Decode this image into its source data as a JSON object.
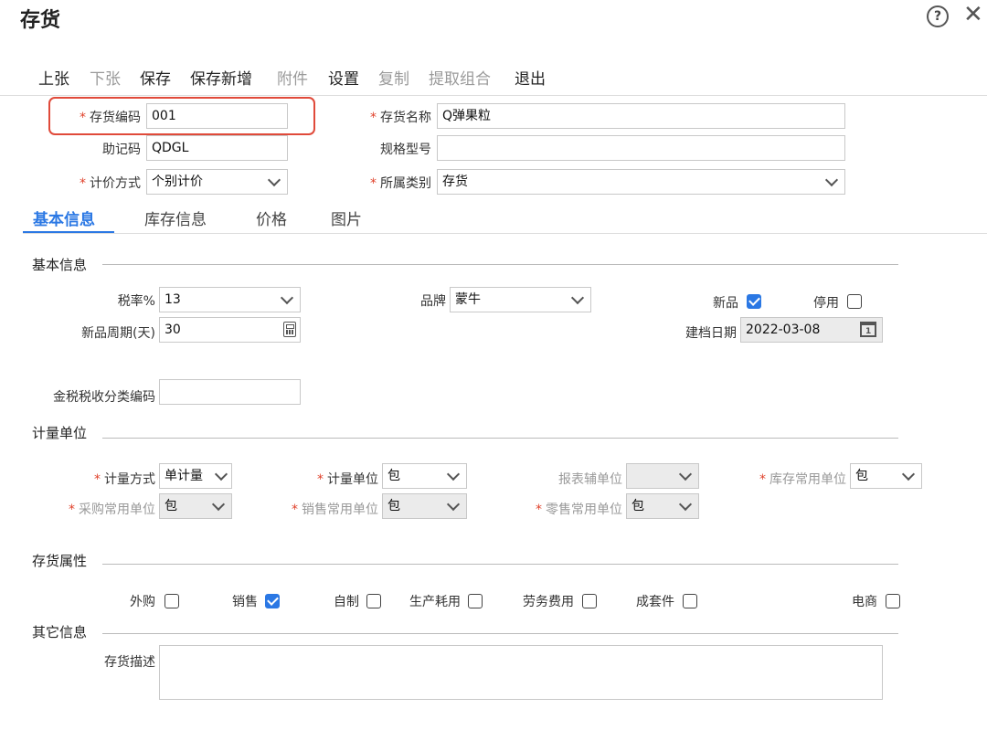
{
  "window": {
    "title": "存货",
    "help_symbol": "?",
    "close_symbol": "✕"
  },
  "toolbar": [
    {
      "label": "上张",
      "enabled": true
    },
    {
      "label": "下张",
      "enabled": false
    },
    {
      "label": "保存",
      "enabled": true
    },
    {
      "label": "保存新增",
      "enabled": true
    },
    {
      "label": "附件",
      "enabled": false
    },
    {
      "label": "设置",
      "enabled": true
    },
    {
      "label": "复制",
      "enabled": false
    },
    {
      "label": "提取组合",
      "enabled": false
    },
    {
      "label": "退出",
      "enabled": true
    }
  ],
  "header": {
    "code_label": "存货编码",
    "code_value": "001",
    "name_label": "存货名称",
    "name_value": "Q弹果粒",
    "mnemonic_label": "助记码",
    "mnemonic_value": "QDGL",
    "spec_label": "规格型号",
    "spec_value": "",
    "pricing_label": "计价方式",
    "pricing_value": "个别计价",
    "category_label": "所属类别",
    "category_value": "存货",
    "required_mark": "*"
  },
  "tabs": [
    {
      "label": "基本信息",
      "active": true
    },
    {
      "label": "库存信息",
      "active": false
    },
    {
      "label": "价格",
      "active": false
    },
    {
      "label": "图片",
      "active": false
    }
  ],
  "basic": {
    "section": "基本信息",
    "tax_label": "税率%",
    "tax_value": "13",
    "brand_label": "品牌",
    "brand_value": "蒙牛",
    "new_label": "新品",
    "new_checked": true,
    "disabled_label": "停用",
    "disabled_checked": false,
    "cycle_label": "新品周期(天)",
    "cycle_value": "30",
    "date_label": "建档日期",
    "date_value": "2022-03-08",
    "taxcode_label": "金税税收分类编码",
    "taxcode_value": ""
  },
  "units": {
    "section": "计量单位",
    "method_label": "计量方式",
    "method_value": "单计量",
    "unit_label": "计量单位",
    "unit_value": "包",
    "report_label": "报表辅单位",
    "report_value": "",
    "stock_label": "库存常用单位",
    "stock_value": "包",
    "purchase_label": "采购常用单位",
    "purchase_value": "包",
    "sales_label": "销售常用单位",
    "sales_value": "包",
    "retail_label": "零售常用单位",
    "retail_value": "包"
  },
  "attrs": {
    "section": "存货属性",
    "items": [
      {
        "label": "外购",
        "checked": false
      },
      {
        "label": "销售",
        "checked": true
      },
      {
        "label": "自制",
        "checked": false
      },
      {
        "label": "生产耗用",
        "checked": false
      },
      {
        "label": "劳务费用",
        "checked": false
      },
      {
        "label": "成套件",
        "checked": false
      },
      {
        "label": "电商",
        "checked": false
      }
    ]
  },
  "other": {
    "section": "其它信息",
    "desc_label": "存货描述",
    "desc_value": ""
  },
  "colors": {
    "accent": "#2b78e4",
    "required": "#e0422b",
    "highlight": "#e04a3a"
  }
}
